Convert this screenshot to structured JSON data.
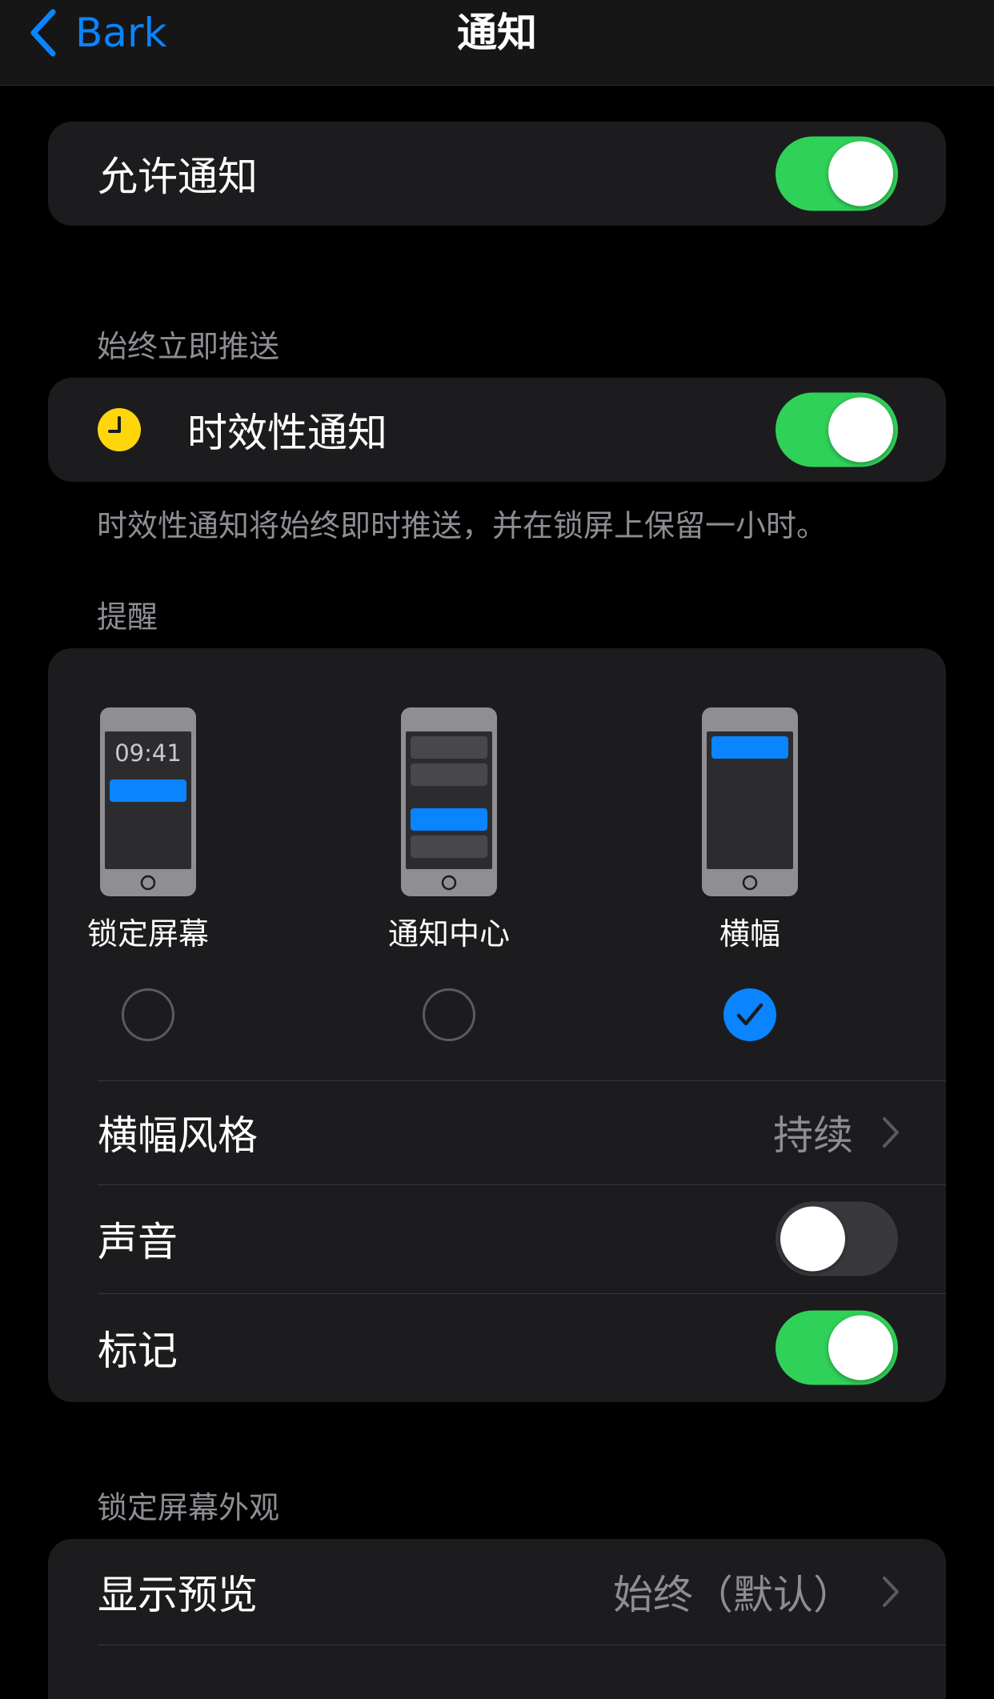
{
  "nav": {
    "back_label": "Bark",
    "title": "通知"
  },
  "allow_notifications": {
    "label": "允许通知",
    "enabled": true
  },
  "deliver_immediately": {
    "header": "始终立即推送",
    "time_sensitive_label": "时效性通知",
    "time_sensitive_enabled": true,
    "footer": "时效性通知将始终即时推送，并在锁屏上保留一小时。"
  },
  "alerts": {
    "header": "提醒",
    "choices": [
      {
        "label": "锁定屏幕",
        "selected": false,
        "clock": "09:41"
      },
      {
        "label": "通知中心",
        "selected": false
      },
      {
        "label": "横幅",
        "selected": true
      }
    ],
    "banner_style_label": "横幅风格",
    "banner_style_value": "持续",
    "sounds_label": "声音",
    "sounds_enabled": false,
    "badges_label": "标记",
    "badges_enabled": true
  },
  "lock_screen_appearance": {
    "header": "锁定屏幕外观",
    "show_previews_label": "显示预览",
    "show_previews_value": "始终（默认）"
  },
  "colors": {
    "accent": "#0a84ff",
    "toggle_on": "#30d158",
    "time_sensitive_icon": "#ffd60a",
    "group_bg": "#1c1c1e",
    "secondary_text": "#8d8d93"
  },
  "icons": {
    "back": "chevron-left-icon",
    "time_sensitive": "clock-icon",
    "disclosure": "chevron-right-icon",
    "selected": "checkmark-icon"
  }
}
